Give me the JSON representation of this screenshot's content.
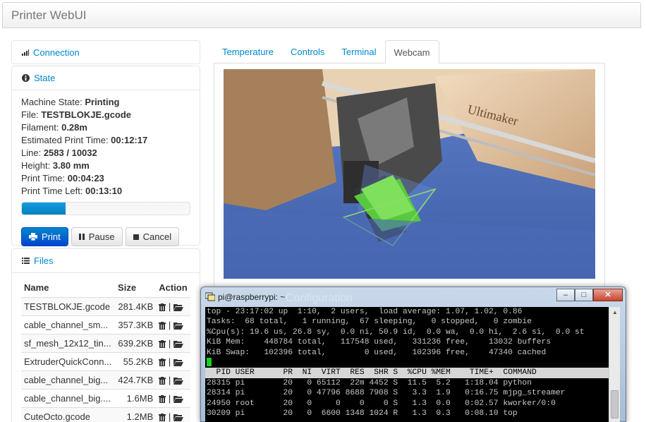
{
  "app": {
    "title": "Printer WebUI"
  },
  "connection": {
    "label": "Connection"
  },
  "state": {
    "header": "State",
    "lines": [
      {
        "label": "Machine State:",
        "value": "Printing"
      },
      {
        "label": "File:",
        "value": "TESTBLOKJE.gcode"
      },
      {
        "label": "Filament:",
        "value": "0.28m"
      },
      {
        "label": "Estimated Print Time:",
        "value": "00:12:17"
      },
      {
        "label": "Line:",
        "value": "2583 / 10032"
      },
      {
        "label": "Height:",
        "value": "3.80 mm"
      },
      {
        "label": "Print Time:",
        "value": "00:04:23"
      },
      {
        "label": "Print Time Left:",
        "value": "00:13:10"
      }
    ],
    "progress": 0.26,
    "buttons": {
      "print": "Print",
      "pause": "Pause",
      "cancel": "Cancel"
    }
  },
  "files": {
    "header": "Files",
    "columns": {
      "name": "Name",
      "size": "Size",
      "action": "Action"
    },
    "rows": [
      {
        "name": "TESTBLOKJE.gcode",
        "size": "281.4KB"
      },
      {
        "name": "cable_channel_sm...",
        "size": "357.3KB"
      },
      {
        "name": "sf_mesh_12x12_tin...",
        "size": "639.2KB"
      },
      {
        "name": "ExtruderQuickConn...",
        "size": "55.2KB"
      },
      {
        "name": "cable_channel_big...",
        "size": "424.7KB"
      },
      {
        "name": "cable_channel_big....",
        "size": "1.6MB"
      },
      {
        "name": "CuteOcto.gcode",
        "size": "1.2MB"
      }
    ],
    "action_separator": " | "
  },
  "tabs": [
    {
      "label": "Temperature"
    },
    {
      "label": "Controls"
    },
    {
      "label": "Terminal"
    },
    {
      "label": "Webcam",
      "active": true
    }
  ],
  "webcam": {
    "brand_text": "Ultimaker"
  },
  "terminal": {
    "title": "pi@raspberrypi: ~",
    "background_title": "Configuration",
    "buttons": {
      "minimize": "–",
      "maximize": "□",
      "close": "✕"
    },
    "lines": [
      "top - 23:17:02 up  1:10,  2 users,  load average: 1.07, 1.02, 0.86",
      "Tasks:  68 total,   1 running,  67 sleeping,   0 stopped,   0 zombie",
      "%Cpu(s): 19.6 us, 26.8 sy,  0.0 ni, 50.9 id,  0.0 wa,  0.0 hi,  2.6 si,  0.0 st",
      "KiB Mem:    448784 total,   117548 used,   331236 free,    13032 buffers",
      "KiB Swap:   102396 total,        0 used,   102396 free,    47340 cached"
    ],
    "table_header": "  PID USER      PR  NI  VIRT  RES  SHR S  %CPU %MEM    TIME+  COMMAND",
    "processes": [
      "28315 pi        20   0 65112  22m 4452 S  11.5  5.2   1:18.04 python",
      "28314 pi        20   0 47796 8688 7908 S   3.3  1.9   0:16.75 mjpg_streamer",
      "24950 root      20   0     0    0    0 S   1.3  0.0   0:02.57 kworker/0:0",
      "30209 pi        20   0  6600 1348 1024 R   1.3  0.3   0:08.10 top"
    ]
  },
  "colors": {
    "link": "#0088cc",
    "primary": "#0044cc",
    "cursor": "#19d219"
  }
}
